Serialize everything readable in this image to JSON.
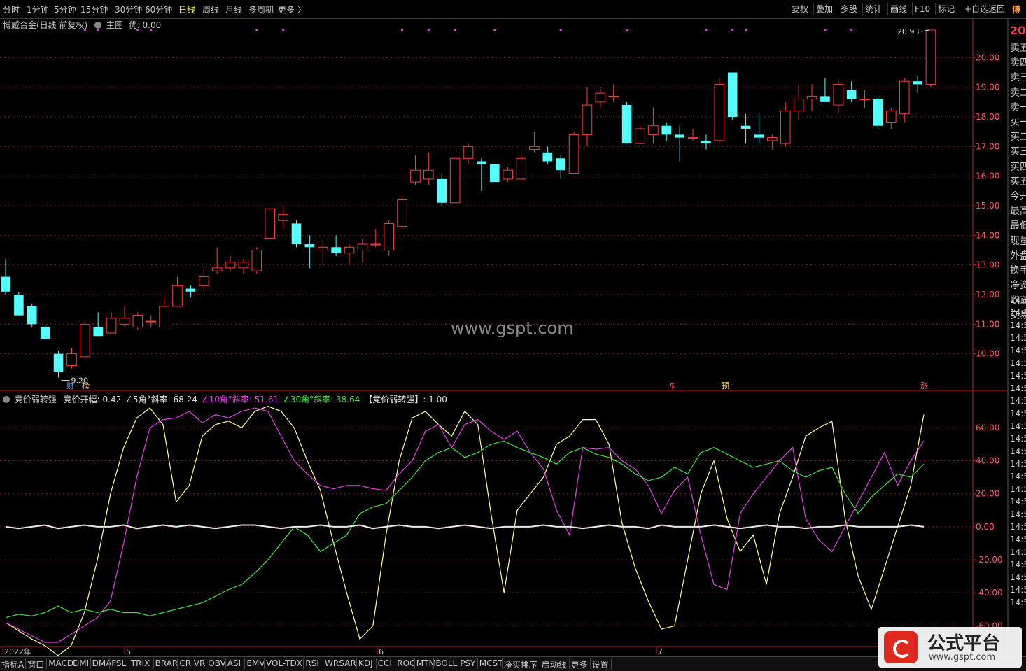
{
  "topbar": {
    "periods": [
      "分时",
      "1分钟",
      "5分钟",
      "15分钟",
      "30分钟",
      "60分钟",
      "日线",
      "周线",
      "月线",
      "多周期",
      "更多 〉"
    ],
    "active_period": "日线",
    "tools": [
      "复权",
      "叠加",
      "多股",
      "统计",
      "画线",
      "F10",
      "标记",
      "+自选",
      "返回"
    ]
  },
  "main_header": {
    "title": "博威合金(日线 前复权)",
    "main_chart_label": "主图",
    "you_label": "优: 0.00"
  },
  "indicator_header": {
    "name": "竞价弱转强",
    "items": [
      {
        "text": "竞价开幅: 0.42",
        "color": "#e0e0e0"
      },
      {
        "text": "∠5角°斜率: 68.24",
        "color": "#e0e0e0"
      },
      {
        "text": "∠10角°斜率: 51.61",
        "color": "#e040e0"
      },
      {
        "text": "∠30角°斜率: 38.64",
        "color": "#40e040"
      },
      {
        "text": "【竞价弱转强】: 1.00",
        "color": "#e0e0e0"
      }
    ]
  },
  "price_axis_labels": [
    "20.00",
    "19.00",
    "18.00",
    "17.00",
    "16.00",
    "15.00",
    "14.00",
    "13.00",
    "12.00",
    "11.00",
    "10.00"
  ],
  "indicator_axis_labels": [
    "60.00",
    "40.00",
    "20.00",
    "0.00",
    "-20.00",
    "-40.00",
    "-60.00"
  ],
  "annotations": {
    "high": "20.93",
    "low": "9.20"
  },
  "markers": [
    "财",
    "榜",
    "$",
    "预",
    "涨"
  ],
  "date_labels": [
    "2022年",
    "5",
    "6",
    "7"
  ],
  "right_panel": {
    "items": [
      "卖五",
      "卖四",
      "卖三",
      "卖二",
      "卖一",
      "买一",
      "买二",
      "买三",
      "买四",
      "买五",
      "今开",
      "最高",
      "最低",
      "现量",
      "外盘",
      "换手",
      "净资",
      "收益",
      "交易"
    ],
    "top_value": "20",
    "time_rows": [
      "14:5",
      "14:5",
      "14:5",
      "14:5",
      "14:5",
      "14:5",
      "14:5",
      "14:5",
      "14:5",
      "14:5",
      "14:5",
      "14:5",
      "14:5",
      "14:5",
      "14:5",
      "14:5",
      "14:5",
      "14:5",
      "14:5",
      "14:5",
      "14:5",
      "14:5",
      "14:5",
      "14:5",
      "14:5"
    ],
    "top_char": "博"
  },
  "bottom_tabs": [
    "指标A",
    "窗口",
    "MACD",
    "DMI",
    "DMA",
    "FSL",
    "TRIX",
    "BRAR",
    "CR",
    "VR",
    "OBV",
    "ASI",
    "EMV",
    "VOL-TDX",
    "RSI",
    "WR",
    "SAR",
    "KDJ",
    "CCI",
    "ROC",
    "MTM",
    "BOLL",
    "PSY",
    "MCST",
    "净买排序",
    "启动线",
    "更多",
    "设置"
  ],
  "watermark": "www.gspt.com",
  "logo": {
    "title": "公式平台",
    "url": "www.gspt.com"
  },
  "colors": {
    "up": "#ff3c3c",
    "down": "#54ffff",
    "grid": "#7a1a1a",
    "axis": "#c02020",
    "white": "#e8e8e8",
    "magenta": "#e040e0",
    "green": "#40e040",
    "yellow": "#ffff80",
    "accent": "#e0281e"
  },
  "chart_data": [
    {
      "type": "candlestick",
      "title": "博威合金(日线 前复权)",
      "y_range": [
        9.0,
        21.0
      ],
      "candles": [
        {
          "o": 12.6,
          "h": 13.2,
          "l": 12.0,
          "c": 12.1
        },
        {
          "o": 12.0,
          "h": 12.1,
          "l": 11.3,
          "c": 11.3
        },
        {
          "o": 11.6,
          "h": 11.7,
          "l": 10.9,
          "c": 11.0
        },
        {
          "o": 10.9,
          "h": 11.0,
          "l": 10.5,
          "c": 10.5
        },
        {
          "o": 10.0,
          "h": 10.1,
          "l": 9.2,
          "c": 9.4
        },
        {
          "o": 9.6,
          "h": 10.2,
          "l": 9.5,
          "c": 10.0
        },
        {
          "o": 9.9,
          "h": 11.1,
          "l": 9.8,
          "c": 11.0
        },
        {
          "o": 10.9,
          "h": 11.4,
          "l": 10.6,
          "c": 10.6
        },
        {
          "o": 10.7,
          "h": 11.4,
          "l": 10.7,
          "c": 11.2
        },
        {
          "o": 11.0,
          "h": 11.6,
          "l": 10.9,
          "c": 11.2
        },
        {
          "o": 10.9,
          "h": 11.4,
          "l": 10.8,
          "c": 11.3
        },
        {
          "o": 11.1,
          "h": 11.3,
          "l": 10.9,
          "c": 11.1
        },
        {
          "o": 10.9,
          "h": 11.9,
          "l": 10.9,
          "c": 11.6
        },
        {
          "o": 11.6,
          "h": 12.6,
          "l": 11.6,
          "c": 12.3
        },
        {
          "o": 12.2,
          "h": 12.3,
          "l": 11.9,
          "c": 12.1
        },
        {
          "o": 12.3,
          "h": 12.9,
          "l": 12.1,
          "c": 12.6
        },
        {
          "o": 12.8,
          "h": 13.6,
          "l": 12.7,
          "c": 12.9
        },
        {
          "o": 12.9,
          "h": 13.3,
          "l": 12.8,
          "c": 13.1
        },
        {
          "o": 12.9,
          "h": 13.2,
          "l": 12.7,
          "c": 13.1
        },
        {
          "o": 12.8,
          "h": 13.6,
          "l": 12.7,
          "c": 13.5
        },
        {
          "o": 13.9,
          "h": 14.9,
          "l": 13.9,
          "c": 14.9
        },
        {
          "o": 14.5,
          "h": 15.0,
          "l": 14.2,
          "c": 14.7
        },
        {
          "o": 14.4,
          "h": 14.5,
          "l": 13.6,
          "c": 13.7
        },
        {
          "o": 13.7,
          "h": 14.0,
          "l": 12.9,
          "c": 13.6
        },
        {
          "o": 13.5,
          "h": 13.8,
          "l": 13.0,
          "c": 13.6
        },
        {
          "o": 13.6,
          "h": 14.0,
          "l": 13.3,
          "c": 13.4
        },
        {
          "o": 13.4,
          "h": 13.7,
          "l": 13.0,
          "c": 13.6
        },
        {
          "o": 13.5,
          "h": 13.9,
          "l": 13.1,
          "c": 13.7
        },
        {
          "o": 13.7,
          "h": 14.2,
          "l": 13.6,
          "c": 13.7
        },
        {
          "o": 13.5,
          "h": 14.5,
          "l": 13.3,
          "c": 14.4
        },
        {
          "o": 14.3,
          "h": 15.3,
          "l": 14.2,
          "c": 15.2
        },
        {
          "o": 15.8,
          "h": 16.7,
          "l": 15.7,
          "c": 16.2
        },
        {
          "o": 15.9,
          "h": 16.8,
          "l": 15.7,
          "c": 16.2
        },
        {
          "o": 15.9,
          "h": 16.1,
          "l": 15.0,
          "c": 15.1
        },
        {
          "o": 15.1,
          "h": 16.6,
          "l": 15.1,
          "c": 16.6
        },
        {
          "o": 16.6,
          "h": 17.1,
          "l": 16.4,
          "c": 17.0
        },
        {
          "o": 16.5,
          "h": 16.6,
          "l": 15.5,
          "c": 16.4
        },
        {
          "o": 16.4,
          "h": 16.4,
          "l": 15.8,
          "c": 15.8
        },
        {
          "o": 15.9,
          "h": 16.3,
          "l": 15.8,
          "c": 16.2
        },
        {
          "o": 15.9,
          "h": 16.7,
          "l": 15.9,
          "c": 16.6
        },
        {
          "o": 16.9,
          "h": 17.5,
          "l": 16.8,
          "c": 17.0
        },
        {
          "o": 16.8,
          "h": 17.0,
          "l": 16.4,
          "c": 16.5
        },
        {
          "o": 16.6,
          "h": 16.7,
          "l": 15.9,
          "c": 16.2
        },
        {
          "o": 16.1,
          "h": 17.5,
          "l": 16.1,
          "c": 17.4
        },
        {
          "o": 17.4,
          "h": 19.0,
          "l": 17.0,
          "c": 18.4
        },
        {
          "o": 18.5,
          "h": 19.0,
          "l": 18.3,
          "c": 18.8
        },
        {
          "o": 18.7,
          "h": 19.1,
          "l": 18.5,
          "c": 18.7
        },
        {
          "o": 18.4,
          "h": 18.5,
          "l": 17.1,
          "c": 17.1
        },
        {
          "o": 17.1,
          "h": 17.7,
          "l": 17.1,
          "c": 17.6
        },
        {
          "o": 17.4,
          "h": 18.3,
          "l": 17.1,
          "c": 17.7
        },
        {
          "o": 17.7,
          "h": 17.8,
          "l": 17.2,
          "c": 17.4
        },
        {
          "o": 17.4,
          "h": 17.7,
          "l": 16.5,
          "c": 17.3
        },
        {
          "o": 17.3,
          "h": 17.6,
          "l": 17.2,
          "c": 17.3
        },
        {
          "o": 17.2,
          "h": 17.4,
          "l": 16.9,
          "c": 17.1
        },
        {
          "o": 17.2,
          "h": 19.3,
          "l": 17.1,
          "c": 19.1
        },
        {
          "o": 19.5,
          "h": 19.5,
          "l": 17.9,
          "c": 18.0
        },
        {
          "o": 17.7,
          "h": 18.1,
          "l": 17.1,
          "c": 17.6
        },
        {
          "o": 17.4,
          "h": 18.1,
          "l": 17.1,
          "c": 17.3
        },
        {
          "o": 17.2,
          "h": 17.4,
          "l": 16.9,
          "c": 17.3
        },
        {
          "o": 17.1,
          "h": 18.5,
          "l": 17.0,
          "c": 18.2
        },
        {
          "o": 18.2,
          "h": 19.1,
          "l": 17.9,
          "c": 18.6
        },
        {
          "o": 18.6,
          "h": 19.1,
          "l": 18.2,
          "c": 18.7
        },
        {
          "o": 18.7,
          "h": 19.3,
          "l": 18.5,
          "c": 18.5
        },
        {
          "o": 18.4,
          "h": 19.2,
          "l": 18.1,
          "c": 19.1
        },
        {
          "o": 18.9,
          "h": 19.2,
          "l": 18.5,
          "c": 18.6
        },
        {
          "o": 18.6,
          "h": 18.9,
          "l": 18.3,
          "c": 18.6
        },
        {
          "o": 18.6,
          "h": 18.7,
          "l": 17.6,
          "c": 17.7
        },
        {
          "o": 17.8,
          "h": 18.3,
          "l": 17.6,
          "c": 18.2
        },
        {
          "o": 18.1,
          "h": 19.3,
          "l": 17.8,
          "c": 19.2
        },
        {
          "o": 19.2,
          "h": 19.4,
          "l": 18.8,
          "c": 19.1
        },
        {
          "o": 19.1,
          "h": 20.93,
          "l": 19.0,
          "c": 20.93
        }
      ]
    },
    {
      "type": "line",
      "title": "竞价弱转强",
      "y_range": [
        -70,
        75
      ],
      "series": [
        {
          "name": "∠5角°斜率",
          "color": "#ffffa0",
          "values": [
            -58,
            -63,
            -68,
            -72,
            -78,
            -72,
            -52,
            -20,
            20,
            48,
            66,
            72,
            62,
            15,
            25,
            55,
            62,
            64,
            60,
            70,
            73,
            70,
            60,
            40,
            22,
            -10,
            -40,
            -68,
            -60,
            -5,
            40,
            66,
            70,
            62,
            55,
            70,
            62,
            8,
            -40,
            10,
            20,
            30,
            50,
            55,
            65,
            65,
            50,
            2,
            -25,
            -45,
            -62,
            -60,
            -20,
            20,
            40,
            5,
            -15,
            -5,
            -35,
            8,
            30,
            55,
            60,
            64,
            5,
            -30,
            -50,
            -25,
            0,
            25,
            68
          ]
        },
        {
          "name": "∠10角°斜率",
          "color": "#e040e0",
          "values": [
            -58,
            -62,
            -66,
            -70,
            -70,
            -65,
            -60,
            -55,
            -45,
            -10,
            30,
            60,
            65,
            66,
            70,
            63,
            68,
            66,
            70,
            72,
            70,
            55,
            40,
            32,
            25,
            23,
            25,
            25,
            23,
            22,
            32,
            40,
            58,
            62,
            48,
            62,
            65,
            58,
            53,
            58,
            45,
            35,
            10,
            -5,
            48,
            47,
            48,
            40,
            35,
            25,
            8,
            22,
            30,
            -5,
            -35,
            -38,
            8,
            20,
            30,
            40,
            48,
            5,
            -8,
            -15,
            0,
            15,
            30,
            45,
            25,
            40,
            52
          ]
        },
        {
          "name": "∠30角°斜率",
          "color": "#40e040",
          "values": [
            -55,
            -53,
            -54,
            -52,
            -48,
            -52,
            -50,
            -52,
            -50,
            -52,
            -52,
            -54,
            -52,
            -50,
            -48,
            -46,
            -42,
            -38,
            -35,
            -28,
            -20,
            -10,
            0,
            -5,
            -15,
            -10,
            -5,
            8,
            12,
            14,
            22,
            30,
            40,
            45,
            48,
            42,
            45,
            50,
            52,
            48,
            45,
            42,
            38,
            45,
            48,
            44,
            42,
            38,
            32,
            28,
            30,
            36,
            32,
            45,
            48,
            44,
            40,
            36,
            38,
            40,
            34,
            30,
            34,
            36,
            20,
            8,
            18,
            25,
            32,
            30,
            38
          ]
        },
        {
          "name": "竞价开幅",
          "color": "#e8e8e8",
          "values": [
            0,
            -1,
            0,
            1,
            -1,
            0,
            1,
            0,
            0,
            1,
            -1,
            0,
            1,
            0,
            1,
            0,
            -1,
            0,
            1,
            1,
            0,
            -1,
            0,
            0,
            1,
            0,
            0,
            1,
            -1,
            0,
            1,
            0,
            0,
            -1,
            0,
            1,
            0,
            -1,
            0,
            0,
            0,
            1,
            0,
            0,
            -1,
            0,
            1,
            0,
            0,
            -1,
            1,
            0,
            0,
            0,
            1,
            0,
            -1,
            0,
            1,
            0,
            0,
            -1,
            0,
            0,
            1,
            0,
            0,
            0,
            0,
            1,
            0
          ]
        }
      ]
    }
  ]
}
